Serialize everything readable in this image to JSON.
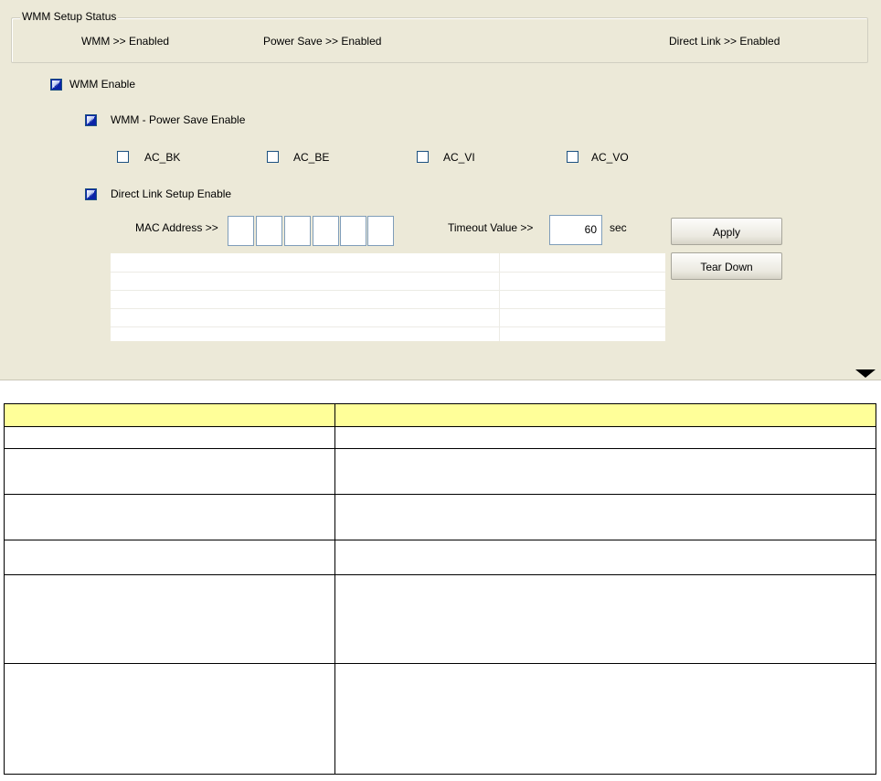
{
  "setup_status": {
    "title": "WMM Setup Status",
    "wmm": "WMM >> Enabled",
    "power_save": "Power Save >> Enabled",
    "direct_link": "Direct Link >> Enabled"
  },
  "options": {
    "wmm_enable": {
      "label": "WMM Enable",
      "checked": true
    },
    "power_save_enable": {
      "label": "WMM - Power Save Enable",
      "checked": true
    },
    "ac": [
      {
        "label": "AC_BK",
        "checked": false
      },
      {
        "label": "AC_BE",
        "checked": false
      },
      {
        "label": "AC_VI",
        "checked": false
      },
      {
        "label": "AC_VO",
        "checked": false
      }
    ],
    "direct_link_enable": {
      "label": "Direct Link Setup Enable",
      "checked": true
    }
  },
  "direct_link": {
    "mac_label": "MAC Address >>",
    "mac_octets": [
      "",
      "",
      "",
      "",
      "",
      ""
    ],
    "timeout_label": "Timeout Value >>",
    "timeout_value": "60",
    "timeout_unit": "sec",
    "apply_label": "Apply",
    "teardown_label": "Tear Down"
  },
  "description_table": {
    "rows": [
      [
        "",
        ""
      ],
      [
        "",
        ""
      ],
      [
        "",
        ""
      ],
      [
        "",
        ""
      ],
      [
        "",
        ""
      ],
      [
        "",
        ""
      ],
      [
        "",
        ""
      ]
    ]
  }
}
